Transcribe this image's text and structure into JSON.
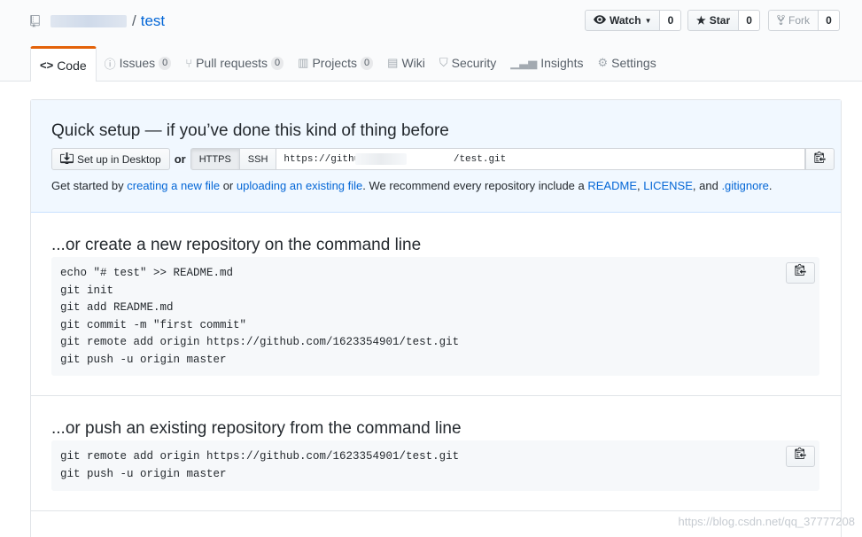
{
  "repo": {
    "owner": "",
    "separator": "/",
    "name": "test"
  },
  "actions": {
    "watch": {
      "label": "Watch",
      "count": "0"
    },
    "star": {
      "label": "Star",
      "count": "0"
    },
    "fork": {
      "label": "Fork",
      "count": "0"
    }
  },
  "tabs": [
    {
      "label": "Code",
      "icon": "code-icon",
      "counter": ""
    },
    {
      "label": "Issues",
      "icon": "issue-icon",
      "counter": "0"
    },
    {
      "label": "Pull requests",
      "icon": "pull-request-icon",
      "counter": "0"
    },
    {
      "label": "Projects",
      "icon": "project-icon",
      "counter": "0"
    },
    {
      "label": "Wiki",
      "icon": "book-icon",
      "counter": ""
    },
    {
      "label": "Security",
      "icon": "shield-icon",
      "counter": ""
    },
    {
      "label": "Insights",
      "icon": "graph-icon",
      "counter": ""
    },
    {
      "label": "Settings",
      "icon": "gear-icon",
      "counter": ""
    }
  ],
  "quick_setup": {
    "title": "Quick setup — if you’ve done this kind of thing before",
    "desktop_button": "Set up in Desktop",
    "or": "or",
    "https": "HTTPS",
    "ssh": "SSH",
    "url": "https://github.com/          /test.git",
    "get_started": {
      "pre": "Get started by",
      "link1": "creating a new file",
      "mid1": "or",
      "link2": "uploading an existing file",
      "mid2": ". We recommend every repository include a",
      "link3": "README",
      "comma1": ",",
      "link4": "LICENSE",
      "mid3": ", and",
      "link5": ".gitignore",
      "end": "."
    }
  },
  "create_section": {
    "title": "...or create a new repository on the command line",
    "lines": [
      "echo \"# test\" >> README.md",
      "git init",
      "git add README.md",
      "git commit -m \"first commit\"",
      "git remote add origin https://github.com/1623354901/test.git",
      "git push -u origin master"
    ]
  },
  "push_section": {
    "title": "...or push an existing repository from the command line",
    "lines": [
      "git remote add origin https://github.com/1623354901/test.git",
      "git push -u origin master"
    ]
  },
  "watermark": "https://blog.csdn.net/qq_37777208",
  "colors": {
    "link": "#0366d6",
    "tab_accent": "#e36209",
    "quick_bg": "#f1f8ff"
  }
}
